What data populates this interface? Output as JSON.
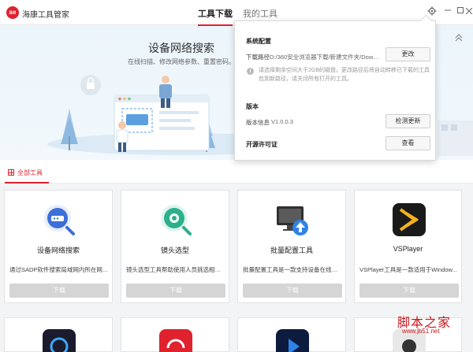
{
  "app": {
    "logo_text": "ae",
    "title": "海康工具管家"
  },
  "tabs": {
    "active": "工具下载",
    "inactive": "我的工具"
  },
  "window_controls": [
    "gear-icon",
    "minimize-icon",
    "maximize-icon",
    "close-icon"
  ],
  "banner": {
    "title": "设备网络搜索",
    "subtitle": "在线扫描、修改网络参数、重置密码。"
  },
  "section": {
    "all_tools": "全部工具"
  },
  "cards": [
    {
      "name": "设备网络搜索",
      "desc": "通过SADP软件搜索局域网内所在网...",
      "button": "下载",
      "icon": "device-search-icon"
    },
    {
      "name": "镜头选型",
      "desc": "镜头选型工具帮助使用人员挑选相机...",
      "button": "下载",
      "icon": "lens-select-icon"
    },
    {
      "name": "批量配置工具",
      "desc": "批量配置工具是一款支持设备在线搜...",
      "button": "下载",
      "icon": "batch-config-icon"
    },
    {
      "name": "VSPlayer",
      "desc": "VSPlayer工具是一款适用于Window...",
      "button": "下载",
      "icon": "vsplayer-icon"
    }
  ],
  "popup": {
    "system_config": "系统配置",
    "download_path_label": "下载路径",
    "download_path_value": "D:/360安全浏览器下载/新建文件夹/Downl...",
    "change_button": "更改",
    "note": "请选择剩余空间大于2GB的磁盘。更改路径后将自动转移已下载的工具包到新路径，请关闭所有打开的工具。",
    "version_head": "版本",
    "version_label": "版本信息",
    "version_value": "V1.0.0.3",
    "check_update_button": "检测更新",
    "license_head": "开源许可证",
    "view_button": "查看"
  },
  "watermark": {
    "text": "脚本之家",
    "url": "www.jb51.net"
  },
  "colors": {
    "brand": "#e0212e",
    "button_disabled": "#d5d5d5"
  }
}
